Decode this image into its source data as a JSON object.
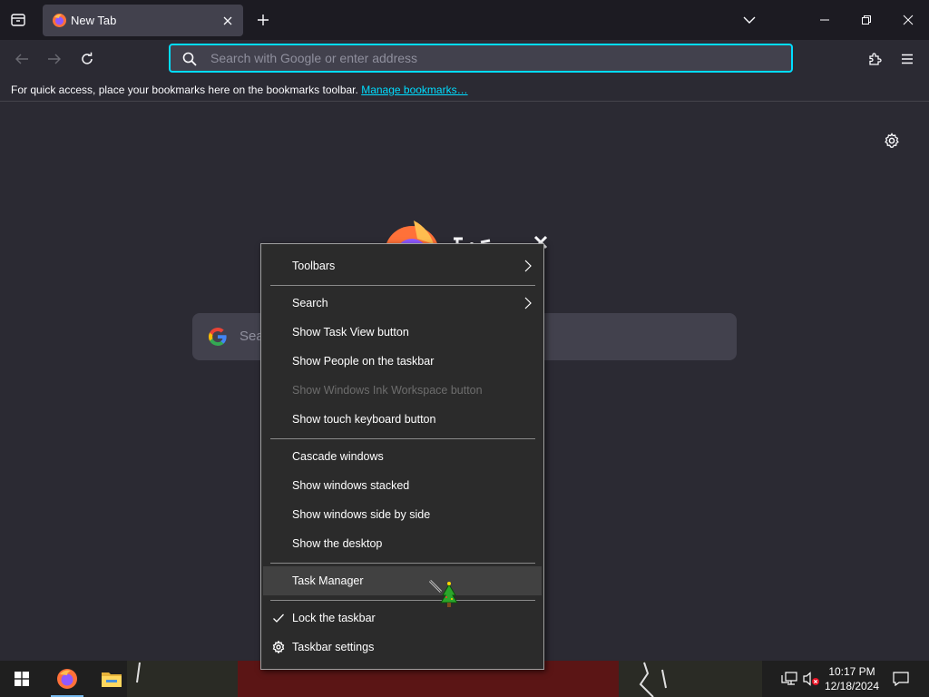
{
  "browser": {
    "tab": {
      "title": "New Tab"
    },
    "urlbar": {
      "placeholder": "Search with Google or enter address",
      "value": ""
    },
    "bookmarks": {
      "message": "For quick access, place your bookmarks here on the bookmarks toolbar.",
      "link": "Manage bookmarks…"
    },
    "newtab": {
      "search_placeholder": "Search"
    },
    "accent_color": "#00ddff"
  },
  "context_menu": {
    "items": [
      {
        "label": "Toolbars",
        "submenu": true
      },
      {
        "label": "Search",
        "submenu": true
      },
      {
        "label": "Show Task View button"
      },
      {
        "label": "Show People on the taskbar"
      },
      {
        "label": "Show Windows Ink Workspace button",
        "disabled": true
      },
      {
        "label": "Show touch keyboard button"
      },
      {
        "label": "Cascade windows"
      },
      {
        "label": "Show windows stacked"
      },
      {
        "label": "Show windows side by side"
      },
      {
        "label": "Show the desktop"
      },
      {
        "label": "Task Manager",
        "highlighted": true
      },
      {
        "label": "Lock the taskbar",
        "checked": true
      },
      {
        "label": "Taskbar settings",
        "icon": "gear-icon"
      }
    ]
  },
  "taskbar": {
    "apps": [
      {
        "name": "firefox-icon",
        "active": true
      },
      {
        "name": "file-explorer-icon",
        "active": false
      }
    ],
    "clock": {
      "time": "10:17 PM",
      "date": "12/18/2024"
    }
  }
}
